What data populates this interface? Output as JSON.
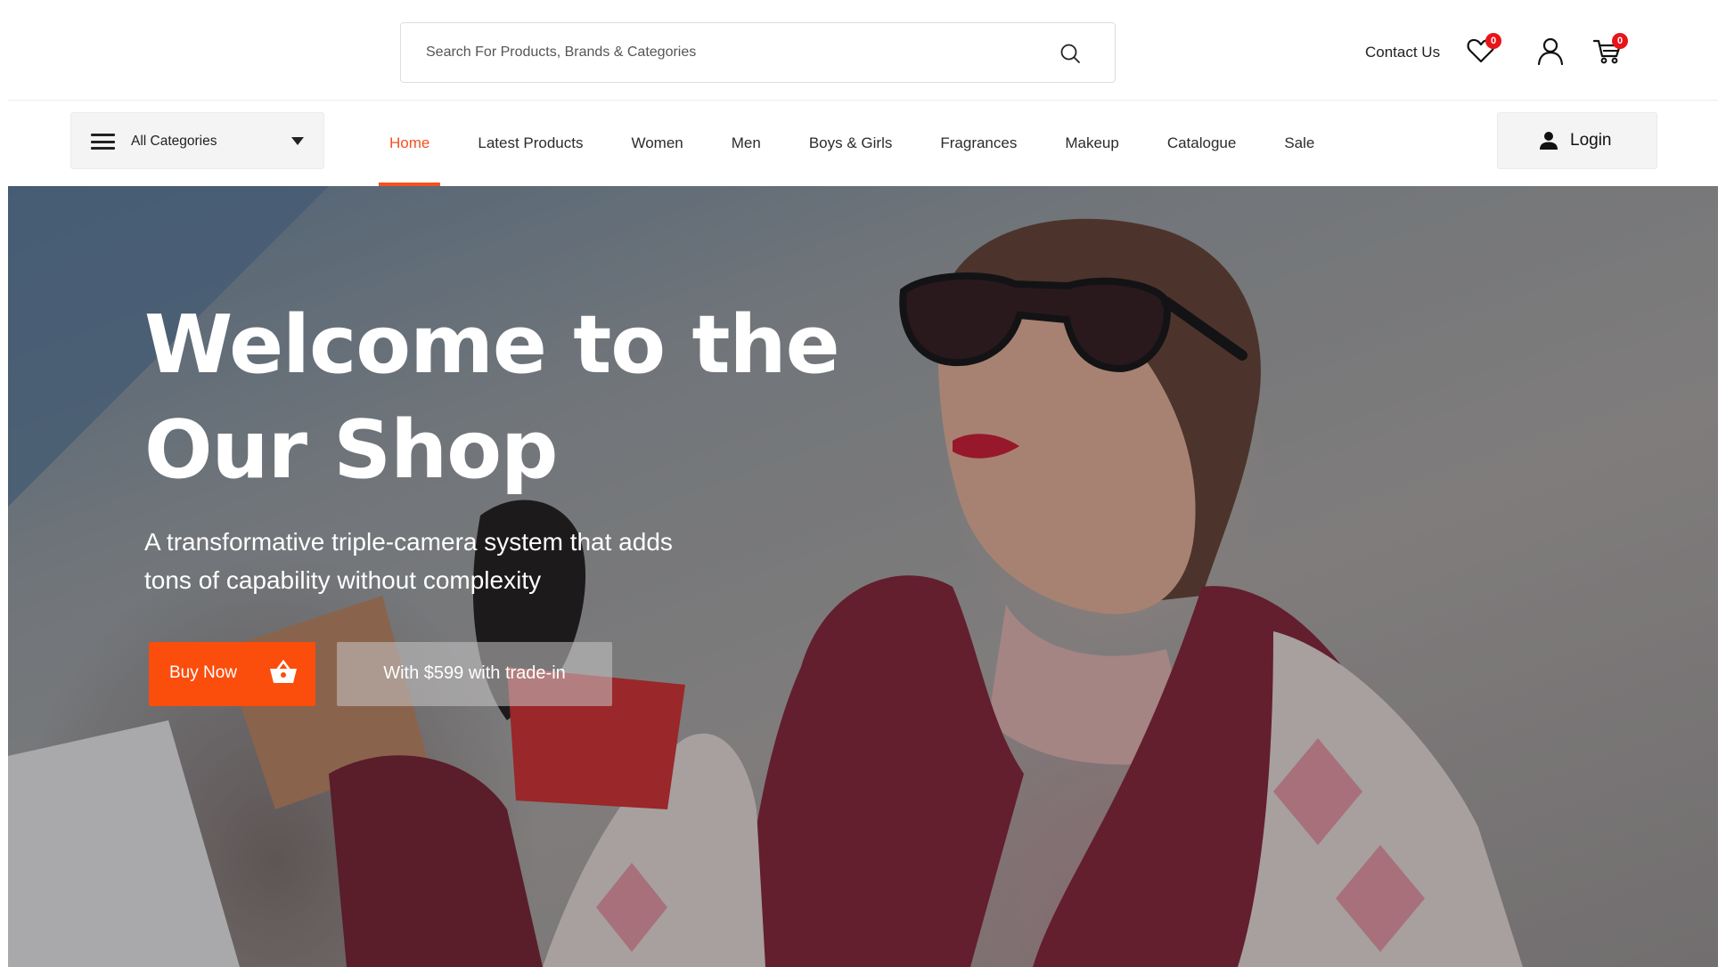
{
  "header": {
    "search": {
      "placeholder": "Search For Products, Brands & Categories",
      "icon": "search-icon"
    },
    "contact_label": "Contact Us",
    "wishlist": {
      "icon": "heart-icon",
      "count": "0"
    },
    "account": {
      "icon": "user-icon"
    },
    "cart": {
      "icon": "cart-icon",
      "count": "0"
    }
  },
  "nav": {
    "categories_label": "All Categories",
    "items": [
      {
        "label": "Home",
        "active": true
      },
      {
        "label": "Latest Products"
      },
      {
        "label": "Women"
      },
      {
        "label": "Men"
      },
      {
        "label": "Boys & Girls"
      },
      {
        "label": "Fragrances"
      },
      {
        "label": "Makeup"
      },
      {
        "label": "Catalogue"
      },
      {
        "label": "Sale"
      }
    ],
    "login_label": "Login"
  },
  "hero": {
    "title_line1": "Welcome to the",
    "title_line2": "Our Shop",
    "subtitle_line1": "A transformative triple-camera system that adds",
    "subtitle_line2": "tons of capability without complexity",
    "buy_label": "Buy Now",
    "trade_label": "With $599 with trade-in"
  },
  "colors": {
    "accent": "#f4511e",
    "button": "#fb4d0c",
    "badge": "#e8141b"
  }
}
